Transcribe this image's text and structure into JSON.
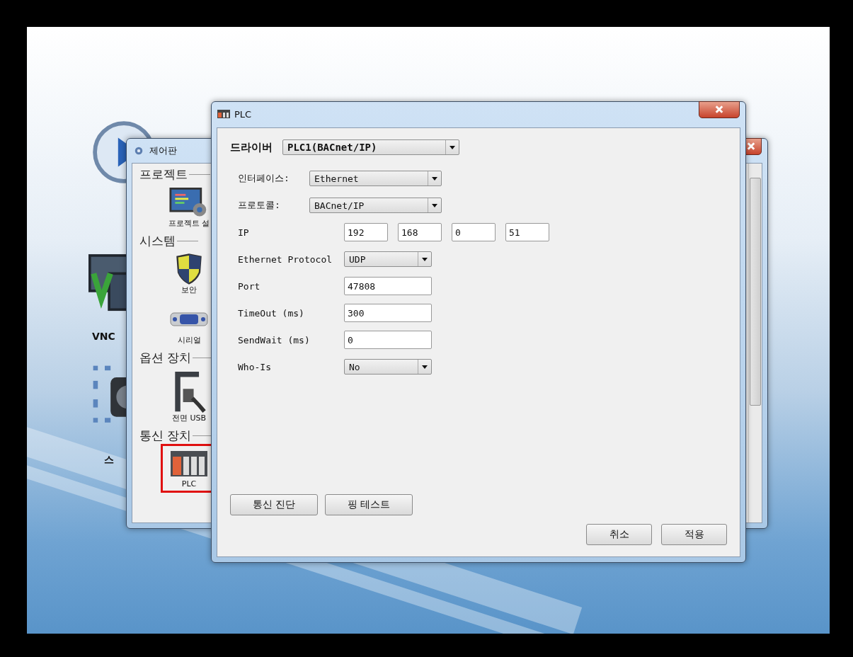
{
  "desktop": {
    "icons": [
      {
        "kind": "play"
      },
      {
        "kind": "vnc",
        "label": "VNC"
      },
      {
        "kind": "camera",
        "label": "스"
      }
    ]
  },
  "control_panel": {
    "title": "제어판",
    "sections": [
      {
        "title": "프로젝트",
        "items": [
          {
            "kind": "project",
            "label": "프로젝트 설",
            "selected": false
          }
        ]
      },
      {
        "title": "시스템",
        "items": [
          {
            "kind": "shield",
            "label": "보안",
            "selected": false
          },
          {
            "kind": "serial",
            "label": "시리얼",
            "selected": false
          }
        ]
      },
      {
        "title": "옵션 장치",
        "items": [
          {
            "kind": "usb",
            "label": "전면 USB",
            "selected": false
          }
        ]
      },
      {
        "title": "통신 장치",
        "items": [
          {
            "kind": "plc",
            "label": "PLC",
            "selected": true
          }
        ]
      }
    ]
  },
  "plc_dialog": {
    "title": "PLC",
    "driver_label": "드라이버",
    "driver": "PLC1(BACnet/IP)",
    "interface_fields": [
      {
        "label": "인터페이스:",
        "value": "Ethernet"
      },
      {
        "label": "프로토콜:",
        "value": "BACnet/IP"
      }
    ],
    "fields": [
      {
        "kind": "ip",
        "label": "IP",
        "values": [
          "192",
          "168",
          "0",
          "51"
        ]
      },
      {
        "kind": "select",
        "label": "Ethernet Protocol",
        "value": "UDP"
      },
      {
        "kind": "input",
        "label": "Port",
        "value": "47808"
      },
      {
        "kind": "input",
        "label": "TimeOut (ms)",
        "value": "300"
      },
      {
        "kind": "input",
        "label": "SendWait (ms)",
        "value": "0"
      },
      {
        "kind": "select",
        "label": "Who-Is",
        "value": "No"
      }
    ],
    "tool_buttons": [
      "통신 진단",
      "핑 테스트"
    ],
    "buttons": [
      "취소",
      "적용"
    ]
  }
}
